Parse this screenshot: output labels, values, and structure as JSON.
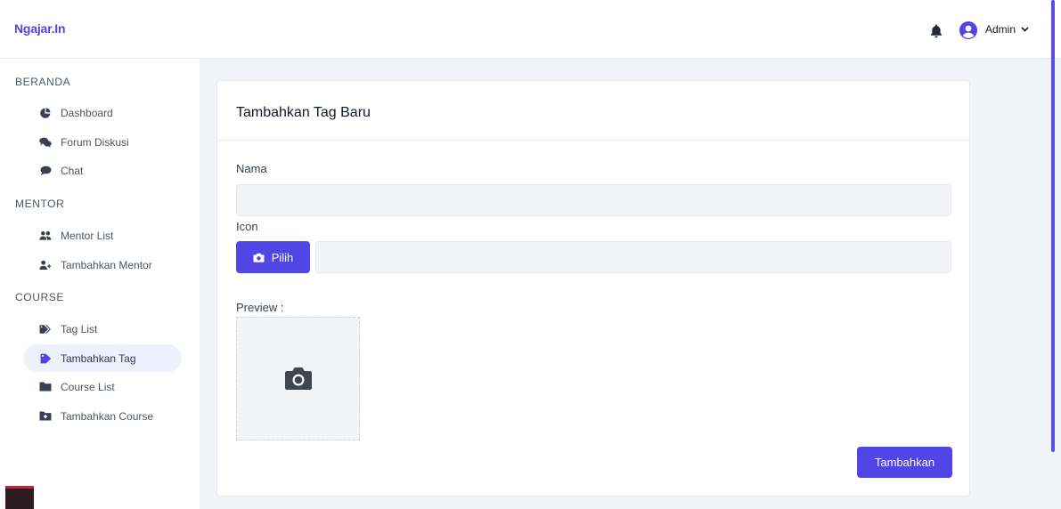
{
  "brand": "Ngajar.In",
  "header": {
    "user_label": "Admin"
  },
  "sidebar": {
    "sections": [
      {
        "title": "BERANDA",
        "items": [
          {
            "label": "Dashboard",
            "icon": "pie-chart-icon"
          },
          {
            "label": "Forum Diskusi",
            "icon": "comments-icon"
          },
          {
            "label": "Chat",
            "icon": "chat-bubble-icon"
          }
        ]
      },
      {
        "title": "MENTOR",
        "items": [
          {
            "label": "Mentor List",
            "icon": "users-icon"
          },
          {
            "label": "Tambahkan Mentor",
            "icon": "user-plus-icon"
          }
        ]
      },
      {
        "title": "COURSE",
        "items": [
          {
            "label": "Tag List",
            "icon": "tags-icon"
          },
          {
            "label": "Tambahkan Tag",
            "icon": "tag-icon",
            "active": true
          },
          {
            "label": "Course List",
            "icon": "folder-icon"
          },
          {
            "label": "Tambahkan Course",
            "icon": "folder-plus-icon"
          }
        ]
      }
    ]
  },
  "form": {
    "title": "Tambahkan Tag Baru",
    "name_label": "Nama",
    "name_value": "",
    "icon_label": "Icon",
    "pick_button": "Pilih",
    "file_value": "",
    "preview_label": "Preview :",
    "submit_button": "Tambahkan"
  },
  "colors": {
    "accent": "#4f46e5",
    "active_bg": "#eef0fb"
  }
}
